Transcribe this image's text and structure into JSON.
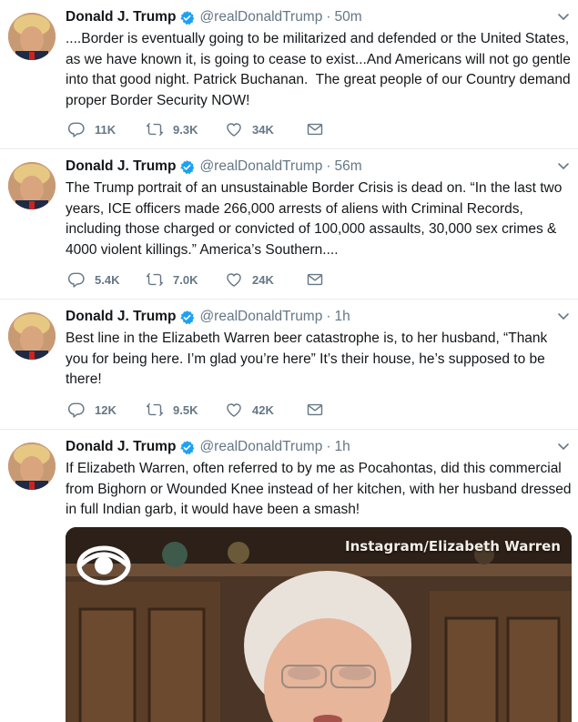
{
  "tweets": [
    {
      "name": "Donald J. Trump",
      "handle": "@realDonaldTrump",
      "separator": "·",
      "time": "50m",
      "text": "....Border is eventually going to be militarized and defended or the United States, as we have known it, is going to cease to exist...And Americans will not go gentle into that good night. Patrick Buchanan.  The great people of our Country demand proper Border Security NOW!",
      "replies": "11K",
      "retweets": "9.3K",
      "likes": "34K"
    },
    {
      "name": "Donald J. Trump",
      "handle": "@realDonaldTrump",
      "separator": "·",
      "time": "56m",
      "text": "The Trump portrait of an unsustainable Border Crisis is dead on. “In the last two years, ICE officers made 266,000 arrests of aliens with Criminal Records, including those charged or convicted of 100,000 assaults, 30,000 sex crimes & 4000 violent killings.” America’s Southern....",
      "replies": "5.4K",
      "retweets": "7.0K",
      "likes": "24K"
    },
    {
      "name": "Donald J. Trump",
      "handle": "@realDonaldTrump",
      "separator": "·",
      "time": "1h",
      "text": "Best line in the Elizabeth Warren beer catastrophe is, to her husband, “Thank you for being here. I’m glad you’re here” It’s their house, he’s supposed to be there!",
      "replies": "12K",
      "retweets": "9.5K",
      "likes": "42K"
    },
    {
      "name": "Donald J. Trump",
      "handle": "@realDonaldTrump",
      "separator": "·",
      "time": "1h",
      "text": "If Elizabeth Warren, often referred to by me as Pocahontas, did this commercial from Bighorn or Wounded Knee instead of her kitchen, with her husband dressed in full Indian garb, it would have been a smash!",
      "media_credit": "Instagram/Elizabeth Warren"
    }
  ],
  "icons": {
    "verified": "verified-badge-icon",
    "caret": "chevron-down-icon",
    "reply": "reply-icon",
    "retweet": "retweet-icon",
    "like": "heart-icon",
    "dm": "envelope-icon",
    "network_logo": "cbs-eye-icon"
  },
  "colors": {
    "verified_blue": "#1da1f2",
    "secondary_text": "#657786",
    "divider": "#e6ecf0"
  }
}
